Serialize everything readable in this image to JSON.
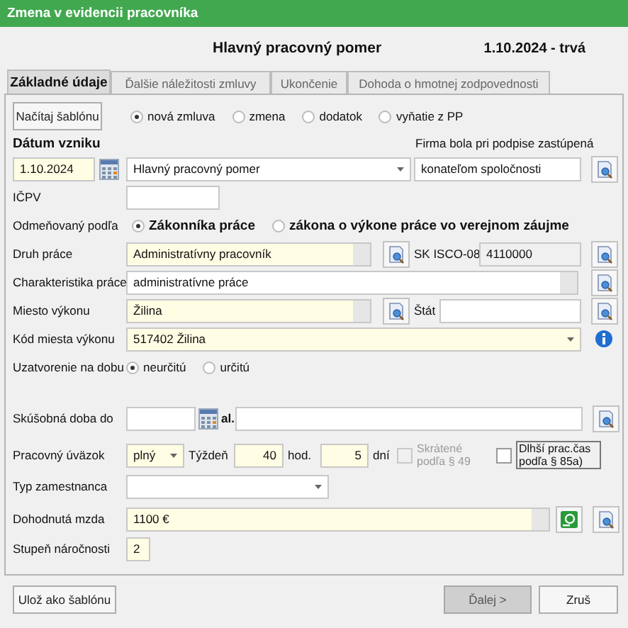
{
  "window": {
    "title": "Zmena v evidencii pracovníka"
  },
  "header": {
    "title": "Hlavný pracovný pomer",
    "period": "1.10.2024 - trvá"
  },
  "tabs": [
    {
      "label": "Základné údaje",
      "selected": true
    },
    {
      "label": "Ďalšie náležitosti zmluvy",
      "selected": false
    },
    {
      "label": "Ukončenie",
      "selected": false
    },
    {
      "label": "Dohoda o hmotnej zodpovednosti",
      "selected": false
    }
  ],
  "load_template_button": "Načítaj šablónu",
  "contract_types": [
    {
      "label": "nová zmluva",
      "selected": true
    },
    {
      "label": "zmena",
      "selected": false
    },
    {
      "label": "dodatok",
      "selected": false
    },
    {
      "label": "vyňatie z PP",
      "selected": false
    }
  ],
  "start_date": {
    "label": "Dátum vzniku",
    "value": "1.10.2024"
  },
  "relation_type": {
    "value": "Hlavný pracovný pomer"
  },
  "representation": {
    "label": "Firma bola pri podpise zastúpená",
    "value": "konateľom spoločnosti"
  },
  "icpv": {
    "label": "IČPV"
  },
  "remuneration": {
    "label": "Odmeňovaný podľa",
    "options": [
      {
        "label": "Zákonníka práce",
        "selected": true
      },
      {
        "label": "zákona o výkone práce vo verejnom záujme",
        "selected": false
      }
    ]
  },
  "work_type": {
    "label": "Druh práce",
    "value": "Administratívny pracovník",
    "isco_label": "SK ISCO-08",
    "isco_value": "4110000"
  },
  "work_description": {
    "label": "Charakteristika práce",
    "value": "administratívne práce"
  },
  "workplace": {
    "label": "Miesto výkonu",
    "value": "Žilina",
    "country_label": "Štát"
  },
  "workplace_code": {
    "label": "Kód miesta výkonu",
    "value": "517402 Žilina"
  },
  "duration": {
    "label": "Uzatvorenie na dobu",
    "options": [
      {
        "label": "neurčitú",
        "selected": true
      },
      {
        "label": "určitú",
        "selected": false
      }
    ]
  },
  "probation": {
    "label": "Skúšobná doba do",
    "separator": "al."
  },
  "workload": {
    "label": "Pracovný úväzok",
    "value": "plný",
    "week_label": "Týždeň",
    "hours": "40",
    "hours_unit": "hod.",
    "days": "5",
    "days_unit": "dní",
    "options": [
      {
        "label": "Skrátené podľa § 49",
        "checked": false,
        "disabled": true
      },
      {
        "label": "Dlhší prac.čas podľa § 85a)",
        "checked": false,
        "disabled": false
      }
    ]
  },
  "employee_type": {
    "label": "Typ zamestnanca"
  },
  "salary": {
    "label": "Dohodnutá mzda",
    "value": "1100 €"
  },
  "difficulty": {
    "label": "Stupeň náročnosti",
    "value": "2"
  },
  "footer": {
    "save_template": "Ulož ako šablónu",
    "next": {
      "label": "Ďalej >",
      "disabled": true
    },
    "cancel": "Zruš"
  }
}
